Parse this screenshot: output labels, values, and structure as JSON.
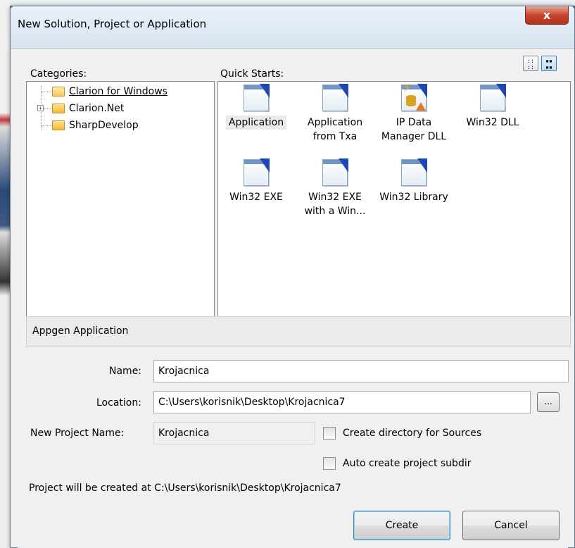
{
  "window": {
    "title": "New Solution, Project or Application",
    "close_glyph": "x"
  },
  "categories": {
    "label": "Categories:",
    "items": [
      {
        "label": "Clarion for Windows",
        "selected": true,
        "expandable": false
      },
      {
        "label": "Clarion.Net",
        "selected": false,
        "expandable": true
      },
      {
        "label": "SharpDevelop",
        "selected": false,
        "expandable": false
      }
    ]
  },
  "quick_starts": {
    "label": "Quick Starts:",
    "items": [
      {
        "label": "Application",
        "icon": "application-icon"
      },
      {
        "label": "Application from Txa",
        "icon": "application-txa-icon"
      },
      {
        "label": "IP Data Manager DLL",
        "icon": "ip-data-manager-icon"
      },
      {
        "label": "Win32 DLL",
        "icon": "win32-dll-icon"
      },
      {
        "label": "Win32 EXE",
        "icon": "win32-exe-icon"
      },
      {
        "label": "Win32 EXE with a Win...",
        "icon": "win32-exe-win-icon"
      },
      {
        "label": "Win32 Library",
        "icon": "win32-library-icon"
      }
    ]
  },
  "description": "Appgen Application",
  "form": {
    "name_label": "Name:",
    "name_value": "Krojacnica",
    "location_label": "Location:",
    "location_value": "C:\\Users\\korisnik\\Desktop\\Krojacnica7",
    "browse_label": "...",
    "project_name_label": "New Project Name:",
    "project_name_value": "Krojacnica",
    "create_dir_label": "Create directory for Sources",
    "auto_subdir_label": "Auto create project subdir",
    "create_dir_checked": false,
    "auto_subdir_checked": false
  },
  "status": "Project will be created at C:\\Users\\korisnik\\Desktop\\Krojacnica7",
  "buttons": {
    "create": "Create",
    "cancel": "Cancel"
  },
  "colors": {
    "close_button": "#c8442a",
    "titlebar": "#d7e4f1",
    "accent": "#3c7fb1"
  }
}
